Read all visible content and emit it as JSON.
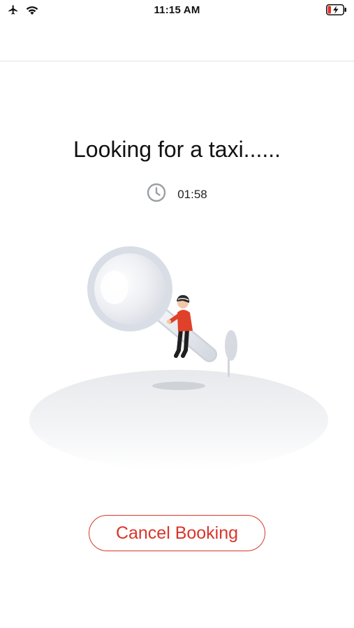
{
  "status_bar": {
    "time": "11:15 AM",
    "icons": [
      "airplane-icon",
      "wifi-icon",
      "battery-charging-icon"
    ]
  },
  "search": {
    "title": "Looking for a taxi......",
    "timer": "01:58",
    "timer_icon": "clock-icon"
  },
  "actions": {
    "cancel_label": "Cancel Booking"
  },
  "colors": {
    "accent": "#d9352b",
    "battery_low": "#e0342b",
    "character_shirt": "#e0412a",
    "magnifier": "#d9dde6"
  }
}
